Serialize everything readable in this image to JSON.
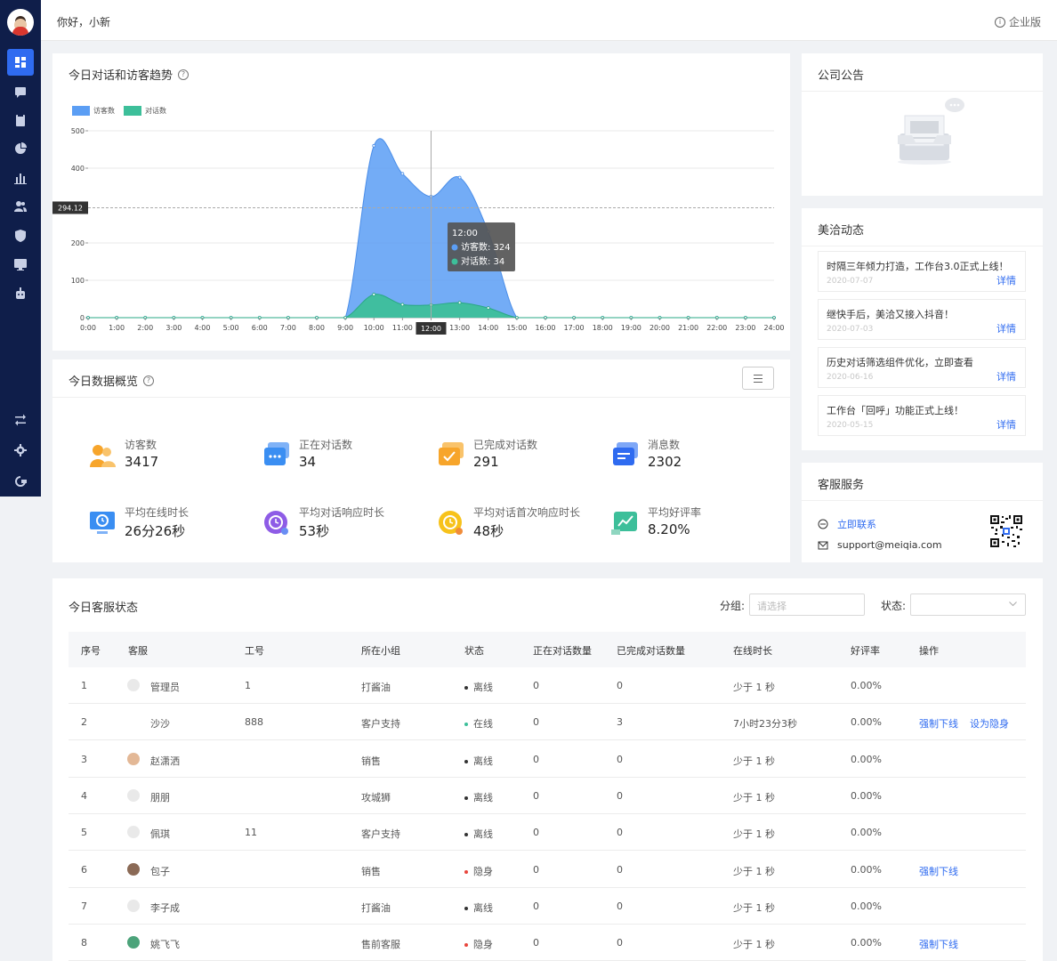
{
  "header": {
    "greeting": "你好，小新",
    "edition": "企业版"
  },
  "sidebar": {
    "items": [
      {
        "name": "dashboard-icon",
        "active": true
      },
      {
        "name": "chat-icon"
      },
      {
        "name": "clipboard-icon"
      },
      {
        "name": "pie-chart-icon"
      },
      {
        "name": "bar-chart-icon"
      },
      {
        "name": "users-icon"
      },
      {
        "name": "shield-icon"
      },
      {
        "name": "monitor-icon"
      },
      {
        "name": "robot-icon"
      }
    ],
    "bottom_items": [
      {
        "name": "switch-icon"
      },
      {
        "name": "gear-icon"
      },
      {
        "name": "logout-icon"
      }
    ]
  },
  "trend": {
    "title": "今日对话和访客趋势",
    "legend": [
      "访客数",
      "对话数"
    ],
    "tooltip": {
      "time": "12:00",
      "visitors_label": "访客数: 324",
      "chats_label": "对话数: 34"
    },
    "axis_pointer_value": "294.12",
    "axis_pointer_x": "12:00"
  },
  "chart_data": {
    "type": "area",
    "x": [
      "0:00",
      "1:00",
      "2:00",
      "3:00",
      "4:00",
      "5:00",
      "6:00",
      "7:00",
      "8:00",
      "9:00",
      "10:00",
      "11:00",
      "12:00",
      "13:00",
      "14:00",
      "15:00",
      "16:00",
      "17:00",
      "18:00",
      "19:00",
      "20:00",
      "21:00",
      "22:00",
      "23:00",
      "24:00"
    ],
    "series": [
      {
        "name": "访客数",
        "color": "#5b9ef4",
        "values": [
          0,
          0,
          0,
          0,
          0,
          0,
          0,
          0,
          0,
          0,
          460,
          385,
          324,
          375,
          230,
          0,
          0,
          0,
          0,
          0,
          0,
          0,
          0,
          0,
          0
        ]
      },
      {
        "name": "对话数",
        "color": "#3dbf9a",
        "values": [
          0,
          0,
          0,
          0,
          0,
          0,
          0,
          0,
          0,
          0,
          62,
          35,
          34,
          40,
          26,
          0,
          0,
          0,
          0,
          0,
          0,
          0,
          0,
          0,
          0
        ]
      }
    ],
    "yticks": [
      0,
      100,
      200,
      400,
      500
    ],
    "ylim": [
      0,
      500
    ],
    "grid": true,
    "legend_position": "top-left"
  },
  "overview": {
    "title": "今日数据概览",
    "metrics": [
      {
        "label": "访客数",
        "value": "3417",
        "icon": "visitors-icon",
        "color": "#f7a52b"
      },
      {
        "label": "正在对话数",
        "value": "34",
        "icon": "chatting-icon",
        "color": "#3a8ef2"
      },
      {
        "label": "已完成对话数",
        "value": "291",
        "icon": "completed-chat-icon",
        "color": "#f7a52b"
      },
      {
        "label": "消息数",
        "value": "2302",
        "icon": "message-icon",
        "color": "#2f6bf0"
      },
      {
        "label": "平均在线时长",
        "value": "26分26秒",
        "icon": "online-time-icon",
        "color": "#3a8ef2"
      },
      {
        "label": "平均对话响应时长",
        "value": "53秒",
        "icon": "response-time-icon",
        "color": "#8e5ce6"
      },
      {
        "label": "平均对话首次响应时长",
        "value": "48秒",
        "icon": "first-response-icon",
        "color": "#f7c21b"
      },
      {
        "label": "平均好评率",
        "value": "8.20%",
        "icon": "rating-icon",
        "color": "#3dbf9a"
      }
    ]
  },
  "notice": {
    "title": "公司公告"
  },
  "news": {
    "title": "美洽动态",
    "items": [
      {
        "title": "时隔三年倾力打造，工作台3.0正式上线！",
        "date": "2020-07-07",
        "link": "详情"
      },
      {
        "title": "继快手后，美洽又接入抖音！",
        "date": "2020-07-03",
        "link": "详情"
      },
      {
        "title": "历史对话筛选组件优化，立即查看",
        "date": "2020-06-16",
        "link": "详情"
      },
      {
        "title": "工作台「回呼」功能正式上线！",
        "date": "2020-05-15",
        "link": "详情"
      }
    ]
  },
  "service": {
    "title": "客服服务",
    "contact": "立即联系",
    "email": "support@meiqia.com"
  },
  "status": {
    "title": "今日客服状态",
    "group_label": "分组:",
    "group_placeholder": "请选择",
    "state_label": "状态:",
    "columns": [
      "序号",
      "客服",
      "工号",
      "所在小组",
      "状态",
      "正在对话数量",
      "已完成对话数量",
      "在线时长",
      "好评率",
      "操作"
    ],
    "rows": [
      {
        "no": "1",
        "name": "管理员",
        "id": "1",
        "group": "打酱油",
        "state": "离线",
        "state_color": "#333333",
        "chatting": "0",
        "done": "0",
        "online": "少于 1 秒",
        "rate": "0.00%",
        "actions": []
      },
      {
        "no": "2",
        "name": "沙沙",
        "id": "888",
        "group": "客户支持",
        "state": "在线",
        "state_color": "#3dbf9a",
        "chatting": "0",
        "done": "3",
        "online": "7小时23分3秒",
        "rate": "0.00%",
        "actions": [
          "强制下线",
          "设为隐身"
        ]
      },
      {
        "no": "3",
        "name": "赵潇洒",
        "id": "",
        "group": "销售",
        "state": "离线",
        "state_color": "#333333",
        "chatting": "0",
        "done": "0",
        "online": "少于 1 秒",
        "rate": "0.00%",
        "actions": []
      },
      {
        "no": "4",
        "name": "朋朋",
        "id": "",
        "group": "攻城狮",
        "state": "离线",
        "state_color": "#333333",
        "chatting": "0",
        "done": "0",
        "online": "少于 1 秒",
        "rate": "0.00%",
        "actions": []
      },
      {
        "no": "5",
        "name": "佩琪",
        "id": "11",
        "group": "客户支持",
        "state": "离线",
        "state_color": "#333333",
        "chatting": "0",
        "done": "0",
        "online": "少于 1 秒",
        "rate": "0.00%",
        "actions": []
      },
      {
        "no": "6",
        "name": "包子",
        "id": "",
        "group": "销售",
        "state": "隐身",
        "state_color": "#e8453c",
        "chatting": "0",
        "done": "0",
        "online": "少于 1 秒",
        "rate": "0.00%",
        "actions": [
          "强制下线"
        ]
      },
      {
        "no": "7",
        "name": "李子成",
        "id": "",
        "group": "打酱油",
        "state": "离线",
        "state_color": "#333333",
        "chatting": "0",
        "done": "0",
        "online": "少于 1 秒",
        "rate": "0.00%",
        "actions": []
      },
      {
        "no": "8",
        "name": "姚飞飞",
        "id": "",
        "group": "售前客服",
        "state": "隐身",
        "state_color": "#e8453c",
        "chatting": "0",
        "done": "0",
        "online": "少于 1 秒",
        "rate": "0.00%",
        "actions": [
          "强制下线"
        ]
      }
    ]
  }
}
